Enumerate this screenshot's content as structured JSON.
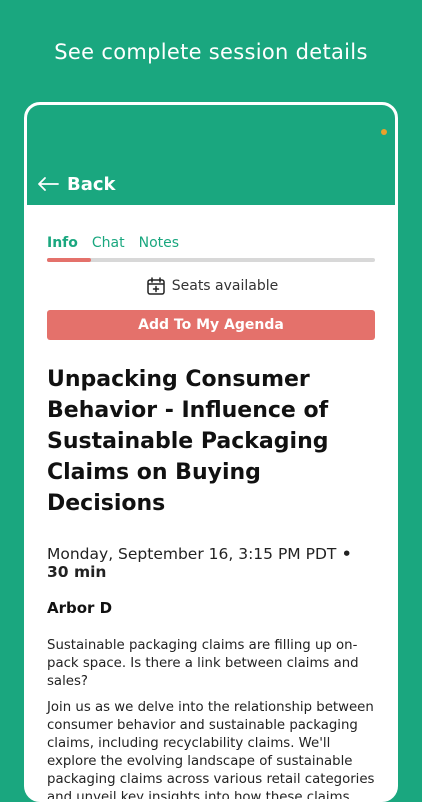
{
  "promo": {
    "heading": "See complete session details"
  },
  "header": {
    "back_label": "Back",
    "back_icon": "arrow-left-icon",
    "status_dot_color": "#e9a12b"
  },
  "tabs": [
    {
      "label": "Info",
      "active": true
    },
    {
      "label": "Chat",
      "active": false
    },
    {
      "label": "Notes",
      "active": false
    }
  ],
  "seats": {
    "label": "Seats available",
    "icon": "calendar-plus-icon"
  },
  "agenda_button": {
    "label": "Add To My Agenda"
  },
  "session": {
    "title_lines": [
      "Unpacking Consumer",
      "Behavior - Influence of",
      "Sustainable Packaging",
      "Claims on Buying Decisions"
    ],
    "datetime": "Monday, September 16, 3:15 PM PDT",
    "separator": " • ",
    "duration": "30 min",
    "location": "Arbor D",
    "description": [
      "Sustainable packaging claims are filling up on-pack space. Is there a link between claims and sales?",
      "Join us as we delve into the relationship between consumer behavior and sustainable packaging claims, including recyclability claims. We'll explore the evolving landscape of sustainable packaging claims across various retail categories and unveil key insights into how these claims impact purchasing decisions."
    ]
  },
  "colors": {
    "brand_green": "#1aa77f",
    "accent_coral": "#e4716b"
  }
}
